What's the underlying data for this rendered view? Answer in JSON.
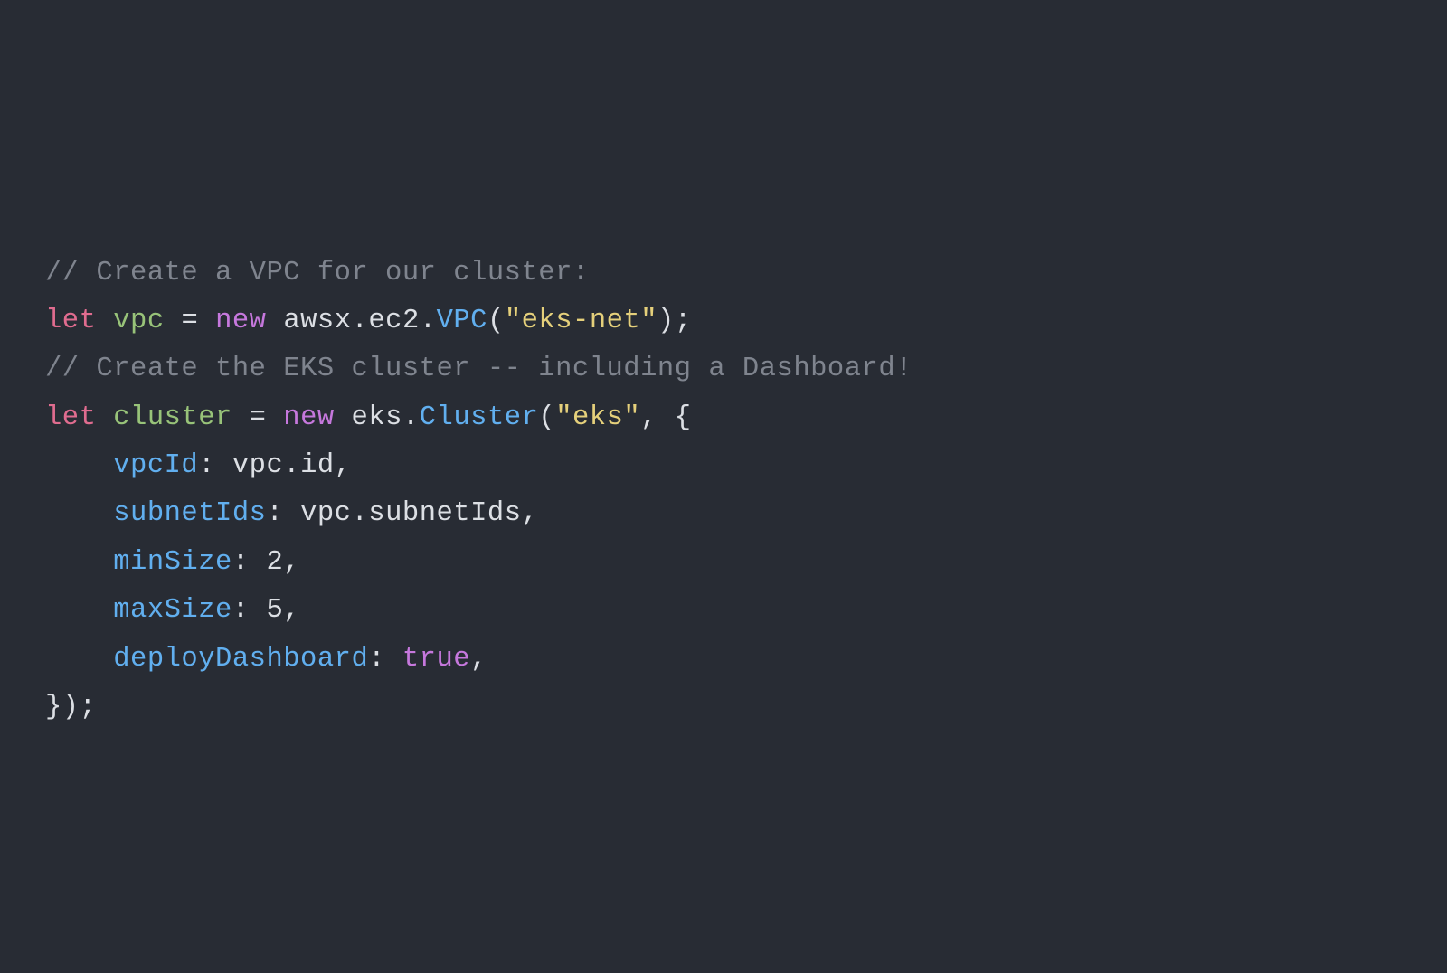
{
  "code": {
    "line1": {
      "comment": "// Create a VPC for our cluster:"
    },
    "line2": {
      "let": "let",
      "vpc": "vpc",
      "eq": " = ",
      "new": "new",
      "sp": " ",
      "awsx": "awsx",
      "dot1": ".",
      "ec2": "ec2",
      "dot2": ".",
      "VPC": "VPC",
      "open": "(",
      "string": "\"eks-net\"",
      "close": ");"
    },
    "line3": {
      "empty": ""
    },
    "line4": {
      "comment": "// Create the EKS cluster -- including a Dashboard!"
    },
    "line5": {
      "let": "let",
      "cluster": "cluster",
      "eq": " = ",
      "new": "new",
      "sp": " ",
      "eks": "eks",
      "dot": ".",
      "Cluster": "Cluster",
      "open": "(",
      "string": "\"eks\"",
      "rest": ", {"
    },
    "line6": {
      "indent": "    ",
      "prop": "vpcId",
      "colon": ": ",
      "vpc": "vpc",
      "dot": ".",
      "id": "id",
      "comma": ","
    },
    "line7": {
      "indent": "    ",
      "prop": "subnetIds",
      "colon": ": ",
      "vpc": "vpc",
      "dot": ".",
      "subnetIds": "subnetIds",
      "comma": ","
    },
    "line8": {
      "indent": "    ",
      "prop": "minSize",
      "colon": ": ",
      "value": "2",
      "comma": ","
    },
    "line9": {
      "indent": "    ",
      "prop": "maxSize",
      "colon": ": ",
      "value": "5",
      "comma": ","
    },
    "line10": {
      "indent": "    ",
      "prop": "deployDashboard",
      "colon": ": ",
      "value": "true",
      "comma": ","
    },
    "line11": {
      "close": "});"
    }
  }
}
